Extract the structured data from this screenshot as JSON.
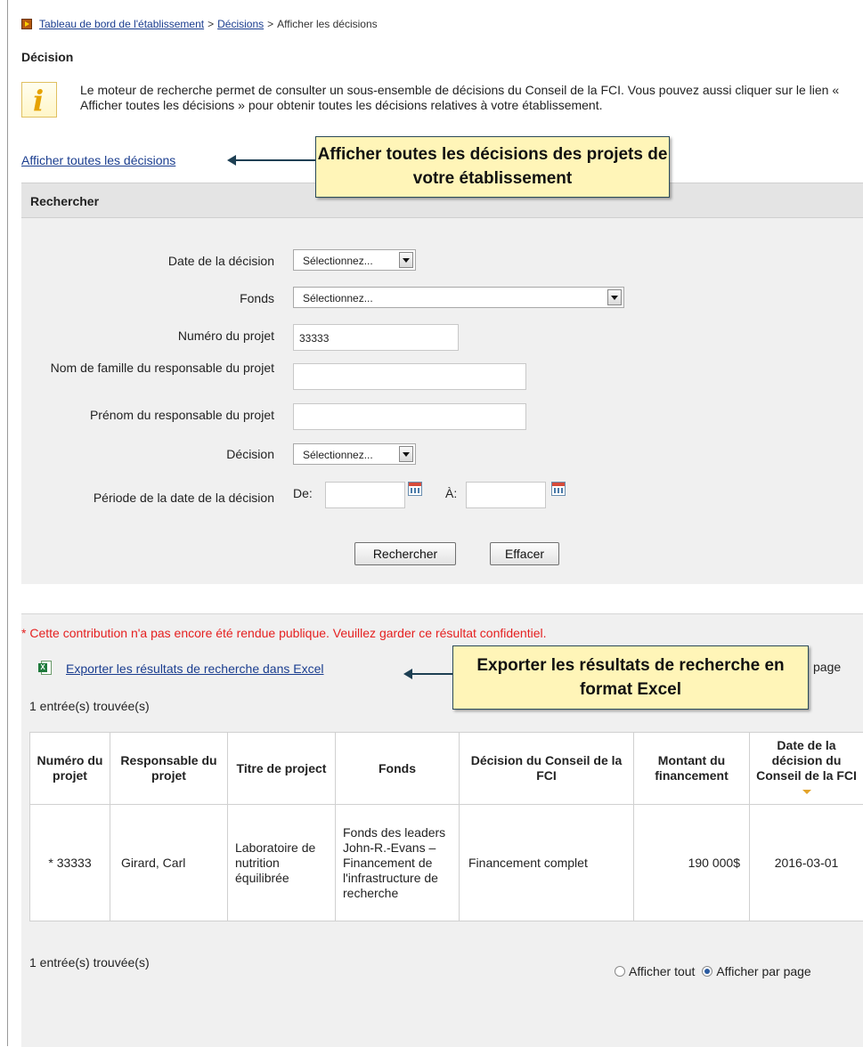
{
  "breadcrumb": {
    "items": [
      "Tableau de bord de l'établissement",
      "Décisions"
    ],
    "separator": ">",
    "current": "Afficher les décisions"
  },
  "section_title": "Décision",
  "info": {
    "icon": "info-icon",
    "text": "Le moteur de recherche permet de consulter un sous-ensemble de décisions du Conseil de la FCI. Vous pouvez aussi cliquer sur le lien « Afficher toutes les décisions » pour obtenir toutes les décisions relatives à votre établissement."
  },
  "show_all_link": "Afficher toutes les décisions",
  "callouts": {
    "show_all": "Afficher toutes les décisions des projets de votre établissement",
    "export": "Exporter les résultats de recherche en format Excel"
  },
  "search": {
    "header": "Rechercher",
    "decision_date": {
      "label": "Date de la décision",
      "value": "Sélectionnez..."
    },
    "fund": {
      "label": "Fonds",
      "value": "Sélectionnez..."
    },
    "project_number": {
      "label": "Numéro du projet",
      "value": "33333"
    },
    "last_name": {
      "label": "Nom de famille du responsable du projet",
      "value": ""
    },
    "first_name": {
      "label": "Prénom du responsable du projet",
      "value": ""
    },
    "decision": {
      "label": "Décision",
      "value": "Sélectionnez..."
    },
    "period": {
      "label": "Période de la date de la décision",
      "from_label": "De:",
      "to_label": "À:",
      "from_value": "",
      "to_value": ""
    },
    "search_button": "Rechercher",
    "clear_button": "Effacer"
  },
  "results": {
    "confidential_note": "* Cette contribution n'a pas encore été rendue publique. Veuillez garder ce résultat confidentiel.",
    "export_link": "Exporter les résultats de recherche dans Excel",
    "export_icon": "excel-icon",
    "page_label": "page",
    "count": "1 entrée(s) trouvée(s)",
    "columns": [
      "Numéro du projet",
      "Responsable du projet",
      "Titre de project",
      "Fonds",
      "Décision du Conseil de la FCI",
      "Montant du financement",
      "Date de la décision du Conseil de la FCI"
    ],
    "rows": [
      {
        "project_number": "* 33333",
        "leader": "Girard, Carl",
        "title": "Laboratoire de nutrition équilibrée",
        "fund": "Fonds des leaders John-R.-Evans – Financement de l'infrastructure de recherche",
        "decision": "Financement complet",
        "amount": "190 000$",
        "date": "2016-03-01"
      }
    ],
    "display_options": {
      "all": "Afficher tout",
      "per_page": "Afficher par page",
      "selected": "per_page"
    }
  },
  "colors": {
    "link": "#1a3d8f",
    "confidential": "#e52020",
    "callout_bg": "#fff5b8",
    "panel_bg": "#f0f0f0"
  }
}
